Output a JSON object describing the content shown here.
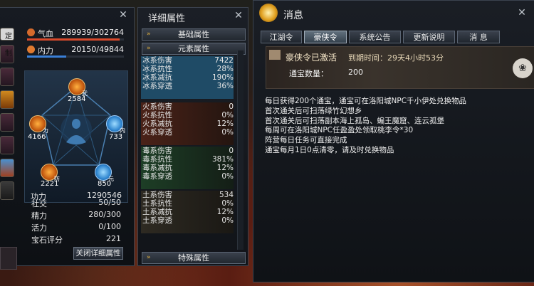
{
  "left_panel": {
    "slot_tag": "定制",
    "hp": {
      "label": "气血",
      "value": "289939/302764",
      "ratio": 0.958,
      "color": "#d94a2c"
    },
    "mp": {
      "label": "内力",
      "value": "20150/49844",
      "ratio": 0.404,
      "color": "#3a7fd6"
    },
    "nodes": [
      {
        "value": "2584",
        "char": "武"
      },
      {
        "value": "4166",
        "char": "力"
      },
      {
        "value": "733",
        "char": "内"
      },
      {
        "value": "2221",
        "char": "防"
      },
      {
        "value": "850",
        "char": "元"
      }
    ],
    "gongli": {
      "label": "功力",
      "value": "1290546"
    },
    "stats": [
      {
        "label": "社交",
        "value": "50/50"
      },
      {
        "label": "精力",
        "value": "280/300"
      },
      {
        "label": "活力",
        "value": "0/100"
      },
      {
        "label": "宝石评分",
        "value": "221"
      }
    ],
    "close_detail_label": "关闭详细属性"
  },
  "mid_panel": {
    "title": "详细属性",
    "sections": {
      "basic": "基础属性",
      "element": "元素属性",
      "special": "特殊属性"
    },
    "groups": [
      {
        "rows": [
          {
            "k": "冰系伤害",
            "v": "7422"
          },
          {
            "k": "冰系抗性",
            "v": "28%"
          },
          {
            "k": "冰系减抗",
            "v": "190%"
          },
          {
            "k": "冰系穿透",
            "v": "36%"
          }
        ]
      },
      {
        "rows": [
          {
            "k": "火系伤害",
            "v": "0"
          },
          {
            "k": "火系抗性",
            "v": "0%"
          },
          {
            "k": "火系减抗",
            "v": "12%"
          },
          {
            "k": "火系穿透",
            "v": "0%"
          }
        ]
      },
      {
        "rows": [
          {
            "k": "毒系伤害",
            "v": "0"
          },
          {
            "k": "毒系抗性",
            "v": "381%"
          },
          {
            "k": "毒系减抗",
            "v": "12%"
          },
          {
            "k": "毒系穿透",
            "v": "0%"
          }
        ]
      },
      {
        "rows": [
          {
            "k": "土系伤害",
            "v": "534"
          },
          {
            "k": "土系抗性",
            "v": "0%"
          },
          {
            "k": "土系减抗",
            "v": "12%"
          },
          {
            "k": "土系穿透",
            "v": "0%"
          }
        ]
      }
    ]
  },
  "right_panel": {
    "title": "消息",
    "tabs": [
      "江湖令",
      "豪侠令",
      "系统公告",
      "更新说明",
      "消 息"
    ],
    "active_tab": 1,
    "banner": {
      "title": "豪侠令已激活",
      "expire": "到期时间：29天4小时53分",
      "coin_label": "通宝数量：",
      "coin_value": "200"
    },
    "description": [
      "每日获得200个通宝，通宝可在洛阳城NPC千小伊处兑换物品",
      "首次通关后可扫荡绿竹幻想乡",
      "首次通关后可扫荡副本海上孤岛、蝙王魔窟、连云孤堡",
      "每周可在洛阳城NPC任盈盈处领取桃李令*30",
      "阵营每日任务可直接完成",
      "通宝每月1日0点清零，请及时兑换物品"
    ]
  }
}
